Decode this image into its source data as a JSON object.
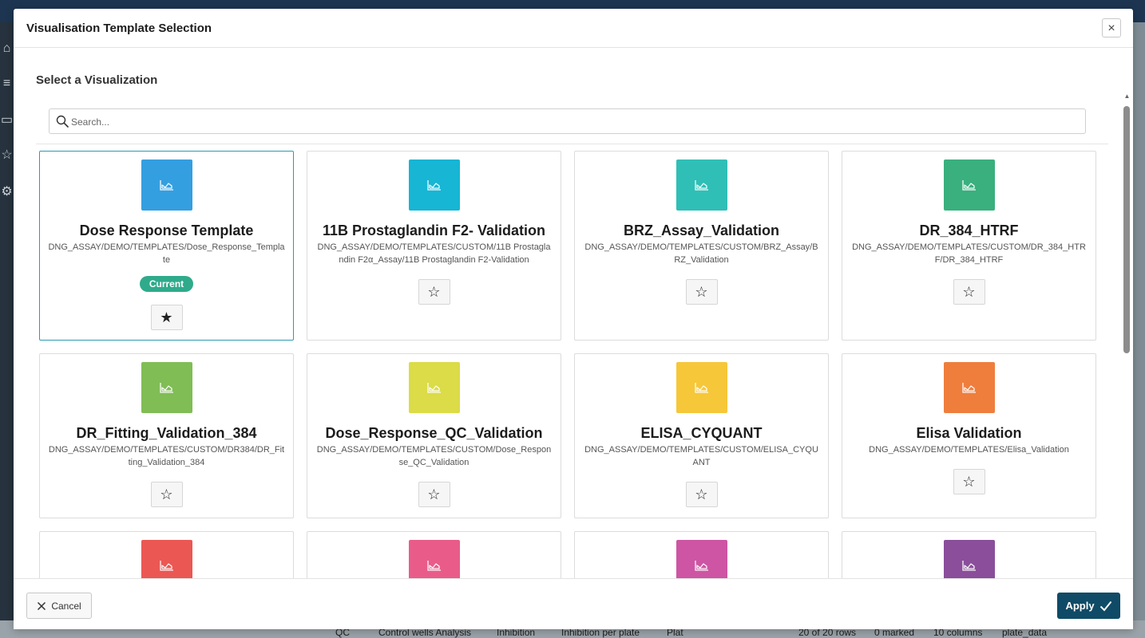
{
  "modal": {
    "title": "Visualisation Template Selection",
    "close_symbol": "×",
    "section_title": "Select a Visualization",
    "search_placeholder": "Search...",
    "current_badge": "Current",
    "cancel_label": "Cancel",
    "apply_label": "Apply"
  },
  "templates": [
    {
      "title": "Dose Response Template",
      "path": "DNG_ASSAY/DEMO/TEMPLATES/Dose_Response_Template",
      "color": "#349fe0",
      "current": true,
      "favorite": true
    },
    {
      "title": "11B Prostaglandin F2- Validation",
      "path": "DNG_ASSAY/DEMO/TEMPLATES/CUSTOM/11B Prostaglandin F2α_Assay/11B Prostaglandin F2-Validation",
      "color": "#16b6d4",
      "current": false,
      "favorite": false
    },
    {
      "title": "BRZ_Assay_Validation",
      "path": "DNG_ASSAY/DEMO/TEMPLATES/CUSTOM/BRZ_Assay/BRZ_Validation",
      "color": "#2fbfb6",
      "current": false,
      "favorite": false
    },
    {
      "title": "DR_384_HTRF",
      "path": "DNG_ASSAY/DEMO/TEMPLATES/CUSTOM/DR_384_HTRF/DR_384_HTRF",
      "color": "#39b07e",
      "current": false,
      "favorite": false
    },
    {
      "title": "DR_Fitting_Validation_384",
      "path": "DNG_ASSAY/DEMO/TEMPLATES/CUSTOM/DR384/DR_Fitting_Validation_384",
      "color": "#80bd55",
      "current": false,
      "favorite": false
    },
    {
      "title": "Dose_Response_QC_Validation",
      "path": "DNG_ASSAY/DEMO/TEMPLATES/CUSTOM/Dose_Response_QC_Validation",
      "color": "#dbdc48",
      "current": false,
      "favorite": false
    },
    {
      "title": "ELISA_CYQUANT",
      "path": "DNG_ASSAY/DEMO/TEMPLATES/CUSTOM/ELISA_CYQUANT",
      "color": "#f6c739",
      "current": false,
      "favorite": false
    },
    {
      "title": "Elisa Validation",
      "path": "DNG_ASSAY/DEMO/TEMPLATES/Elisa_Validation",
      "color": "#ef7e3d",
      "current": false,
      "favorite": false
    },
    {
      "title": "",
      "path": "",
      "color": "#eb5753",
      "current": false,
      "favorite": false
    },
    {
      "title": "",
      "path": "",
      "color": "#e95c8a",
      "current": false,
      "favorite": false
    },
    {
      "title": "",
      "path": "",
      "color": "#cd55a3",
      "current": false,
      "favorite": false
    },
    {
      "title": "",
      "path": "",
      "color": "#8a4e9b",
      "current": false,
      "favorite": false
    }
  ],
  "icons": {
    "thumbnail": "area-chart-icon",
    "favorite_off": "☆",
    "favorite_on": "★",
    "search": "search-icon",
    "cancel": "close-icon",
    "apply": "check-icon"
  },
  "background": {
    "bottom_tabs": [
      "QC",
      "Control wells Analysis",
      "Inhibition",
      "Inhibition per plate",
      "Plat",
      "20 of 20 rows",
      "0 marked",
      "10 columns",
      "plate_data"
    ]
  }
}
